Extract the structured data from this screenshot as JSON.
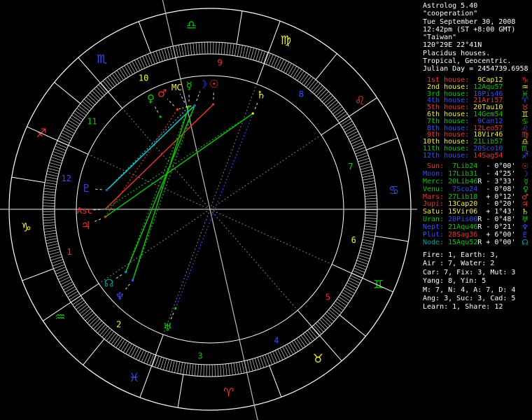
{
  "palette": {
    "red": "#f03232",
    "yellow": "#f2f22a",
    "green": "#00cc00",
    "blue": "#3a4cff",
    "cyan": "#00dcdc",
    "teal": "#00a0a0",
    "white": "#ffffff",
    "gray": "#b9b9b9",
    "dkgray": "#999999",
    "pointer": "#e0e0e0",
    "tick": "#cfcfcf"
  },
  "sidebar": {
    "header_lines": [
      "Astrolog 5.40",
      "\"cooperation\"",
      "Tue September 30, 2008",
      "12:42pm (ST +8:00 GMT)",
      "\"Taiwan\"",
      "120°29E 22°41N",
      "Placidus houses.",
      "Tropical, Geocentric.",
      "Julian Day = 2454739.6958"
    ],
    "houses": [
      {
        "label": " 1st house:",
        "value": "  9Cap12",
        "label_color": "red",
        "value_color": "yellow",
        "glyph": "♑",
        "glyph_color": "red"
      },
      {
        "label": " 2nd house:",
        "value": " 12Aqu57",
        "label_color": "yellow",
        "value_color": "green",
        "glyph": "♒",
        "glyph_color": "yellow"
      },
      {
        "label": " 3rd house:",
        "value": " 18Pis46",
        "label_color": "green",
        "value_color": "blue",
        "glyph": "♓",
        "glyph_color": "green"
      },
      {
        "label": " 4th house:",
        "value": " 21Ari57",
        "label_color": "blue",
        "value_color": "red",
        "glyph": "♈",
        "glyph_color": "blue"
      },
      {
        "label": " 5th house:",
        "value": " 20Tau10",
        "label_color": "red",
        "value_color": "yellow",
        "glyph": "♉",
        "glyph_color": "red"
      },
      {
        "label": " 6th house:",
        "value": " 14Gem54",
        "label_color": "yellow",
        "value_color": "green",
        "glyph": "♊",
        "glyph_color": "yellow"
      },
      {
        "label": " 7th house:",
        "value": "  9Can12",
        "label_color": "green",
        "value_color": "blue",
        "glyph": "♋",
        "glyph_color": "green"
      },
      {
        "label": " 8th house:",
        "value": " 12Leo57",
        "label_color": "blue",
        "value_color": "red",
        "glyph": "♌",
        "glyph_color": "blue"
      },
      {
        "label": " 9th house:",
        "value": " 18Vir46",
        "label_color": "red",
        "value_color": "yellow",
        "glyph": "♍",
        "glyph_color": "red"
      },
      {
        "label": "10th house:",
        "value": " 21Lib57",
        "label_color": "yellow",
        "value_color": "green",
        "glyph": "♎",
        "glyph_color": "yellow"
      },
      {
        "label": "11th house:",
        "value": " 20Sco10",
        "label_color": "green",
        "value_color": "blue",
        "glyph": "♏",
        "glyph_color": "green"
      },
      {
        "label": "12th house:",
        "value": " 14Sag54",
        "label_color": "blue",
        "value_color": "red",
        "glyph": "♐",
        "glyph_color": "blue"
      }
    ],
    "planets": [
      {
        "label": " Sun:",
        "value": "  7Lib24",
        "retro": " ",
        "delta": "- 0°00'",
        "label_color": "red",
        "value_color": "green",
        "glyph": "☉",
        "glyph_color": "red"
      },
      {
        "label": "Moon:",
        "value": " 17Lib31",
        "retro": " ",
        "delta": "- 4°25'",
        "label_color": "blue",
        "value_color": "green",
        "glyph": "☽",
        "glyph_color": "blue"
      },
      {
        "label": "Merc:",
        "value": " 20Lib46",
        "retro": "R",
        "delta": "- 3°33'",
        "label_color": "green",
        "value_color": "green",
        "glyph": "☿",
        "glyph_color": "green"
      },
      {
        "label": "Venu:",
        "value": "  7Sco24",
        "retro": " ",
        "delta": "- 0°08'",
        "label_color": "green",
        "value_color": "blue",
        "glyph": "♀",
        "glyph_color": "green"
      },
      {
        "label": "Mars:",
        "value": " 27Lib18",
        "retro": " ",
        "delta": "+ 0°12'",
        "label_color": "red",
        "value_color": "green",
        "glyph": "♂",
        "glyph_color": "red"
      },
      {
        "label": "Jupi:",
        "value": " 13Cap20",
        "retro": " ",
        "delta": "- 0°20'",
        "label_color": "red",
        "value_color": "yellow",
        "glyph": "♃",
        "glyph_color": "red"
      },
      {
        "label": "Satu:",
        "value": " 15Vir06",
        "retro": " ",
        "delta": "+ 1°43'",
        "label_color": "yellow",
        "value_color": "yellow",
        "glyph": "♄",
        "glyph_color": "yellow"
      },
      {
        "label": "Uran:",
        "value": " 20Pis00",
        "retro": "R",
        "delta": "- 0°48'",
        "label_color": "green",
        "value_color": "blue",
        "glyph": "♅",
        "glyph_color": "green"
      },
      {
        "label": "Nept:",
        "value": " 21Aqu46",
        "retro": "R",
        "delta": "- 0°21'",
        "label_color": "blue",
        "value_color": "green",
        "glyph": "♆",
        "glyph_color": "blue"
      },
      {
        "label": "Plut:",
        "value": " 28Sag36",
        "retro": " ",
        "delta": "+ 6°00'",
        "label_color": "blue",
        "value_color": "red",
        "glyph": "♇",
        "glyph_color": "blue"
      },
      {
        "label": "Node:",
        "value": " 15Aqu52",
        "retro": "R",
        "delta": "+ 0°00'",
        "label_color": "teal",
        "value_color": "green",
        "glyph": "☊",
        "glyph_color": "teal"
      }
    ],
    "stats_lines": [
      "Fire: 1, Earth: 3,",
      "Air : 7, Water: 2",
      "Car: 7, Fix: 3, Mut: 3",
      "Yang: 8, Yin: 5",
      "M: 7, N: 4, A: 7, D: 4",
      "Ang: 3, Suc: 3, Cad: 5",
      "Learn: 1, Share: 12"
    ]
  },
  "wheel": {
    "asc": 279.2,
    "cusps": [
      279.2,
      312.95,
      348.77,
      21.95,
      50.17,
      74.9,
      99.2,
      132.95,
      168.77,
      201.95,
      230.17,
      254.9
    ],
    "axis_houses": [
      0,
      3,
      6,
      9
    ],
    "axes": [
      {
        "lon": 279.2,
        "r_out": 300,
        "r_in": -296
      },
      {
        "lon": 201.95,
        "r_out": 307,
        "r_in": -309
      }
    ],
    "house_numbers": [
      "1",
      "2",
      "3",
      "4",
      "5",
      "6",
      "7",
      "8",
      "9",
      "10",
      "11",
      "12"
    ],
    "number_colors": [
      "red",
      "yellow",
      "green",
      "blue"
    ],
    "signs": [
      {
        "name": "Aries",
        "glyph": "♈",
        "color": "red"
      },
      {
        "name": "Taurus",
        "glyph": "♉",
        "color": "yellow"
      },
      {
        "name": "Gemini",
        "glyph": "♊",
        "color": "green"
      },
      {
        "name": "Cancer",
        "glyph": "♋",
        "color": "blue"
      },
      {
        "name": "Leo",
        "glyph": "♌",
        "color": "red"
      },
      {
        "name": "Virgo",
        "glyph": "♍",
        "color": "yellow"
      },
      {
        "name": "Libra",
        "glyph": "♎",
        "color": "green"
      },
      {
        "name": "Scorpio",
        "glyph": "♏",
        "color": "blue"
      },
      {
        "name": "Sagittarius",
        "glyph": "♐",
        "color": "red"
      },
      {
        "name": "Capricorn",
        "glyph": "♑",
        "color": "yellow"
      },
      {
        "name": "Aquarius",
        "glyph": "♒",
        "color": "green"
      },
      {
        "name": "Pisces",
        "glyph": "♓",
        "color": "blue"
      }
    ],
    "objects": [
      {
        "name": "Sun",
        "glyph": "☉",
        "color": "red",
        "lon": 187.4,
        "gd": 0,
        "label": false
      },
      {
        "name": "Moon",
        "glyph": "☽",
        "color": "blue",
        "lon": 197.52,
        "gd": -5,
        "label": false
      },
      {
        "name": "Mercury",
        "glyph": "☿",
        "color": "green",
        "lon": 200.77,
        "gd": -2,
        "label": false
      },
      {
        "name": "Venus",
        "glyph": "♀",
        "color": "green",
        "lon": 217.4,
        "gd": 0,
        "label": false
      },
      {
        "name": "Mars",
        "glyph": "♂",
        "color": "red",
        "lon": 207.3,
        "gd": 4.3,
        "label": false
      },
      {
        "name": "Jupiter",
        "glyph": "♃",
        "color": "red",
        "lon": 283.33,
        "gd": 3.3,
        "label": false
      },
      {
        "name": "Saturn",
        "glyph": "♄",
        "color": "yellow",
        "lon": 165.1,
        "gd": 0,
        "label": false
      },
      {
        "name": "Uranus",
        "glyph": "♅",
        "color": "green",
        "lon": 350.0,
        "gd": -0.6,
        "label": false
      },
      {
        "name": "Neptune",
        "glyph": "♆",
        "color": "blue",
        "lon": 321.77,
        "gd": 1.5,
        "label": false
      },
      {
        "name": "Pluto",
        "glyph": "♇",
        "color": "blue",
        "lon": 268.6,
        "gd": 1,
        "label": false
      },
      {
        "name": "Node",
        "glyph": "☊",
        "color": "teal",
        "lon": 315.87,
        "gd": -0.5,
        "label": false
      },
      {
        "name": "MC",
        "glyph": "MC",
        "color": "yellow",
        "lon": 201.95,
        "gd": 2.5,
        "label": true
      },
      {
        "name": "Asc",
        "glyph": "Asc",
        "color": "red",
        "lon": 279.2,
        "gd": 0.5,
        "label": true
      }
    ],
    "aspects": [
      {
        "a": "Asc",
        "b": "Sun",
        "color": "red",
        "style": "solid"
      },
      {
        "a": "Jupiter",
        "b": "Mars",
        "color": "red",
        "style": "dotted"
      },
      {
        "a": "Jupiter",
        "b": "Saturn",
        "color": "green",
        "style": "solid"
      },
      {
        "a": "Asc",
        "b": "Saturn",
        "color": "green",
        "style": "dotted"
      },
      {
        "a": "Pluto",
        "b": "Moon",
        "color": "cyan",
        "style": "solid"
      },
      {
        "a": "Pluto",
        "b": "Mercury",
        "color": "cyan",
        "style": "dotted"
      },
      {
        "a": "Mercury",
        "b": "Neptune",
        "color": "green",
        "style": "solid"
      },
      {
        "a": "Moon",
        "b": "Node",
        "color": "green",
        "style": "solid"
      },
      {
        "a": "Moon",
        "b": "Neptune",
        "color": "green",
        "style": "dotted"
      },
      {
        "a": "Mercury",
        "b": "Node",
        "color": "green",
        "style": "dotted"
      },
      {
        "a": "Saturn",
        "b": "Uranus",
        "color": "blue",
        "style": "dotted"
      },
      {
        "a": "MC",
        "b": "Mercury",
        "color": "yellow",
        "style": "dotted"
      },
      {
        "a": "MC",
        "b": "Moon",
        "color": "yellow",
        "style": "dotted"
      },
      {
        "a": "MC",
        "b": "Mars",
        "color": "yellow",
        "style": "dotted"
      }
    ]
  }
}
